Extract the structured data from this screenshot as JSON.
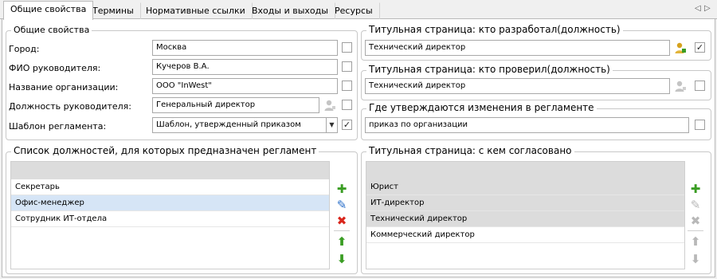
{
  "tabs": [
    "Общие свойства",
    "Термины",
    "Нормативные ссылки",
    "Входы и выходы",
    "Ресурсы"
  ],
  "tab_nav": {
    "prev": "◁",
    "next": "▷"
  },
  "general": {
    "title": "Общие свойства",
    "rows": [
      {
        "label": "Город:",
        "value": "Москва",
        "checked": false
      },
      {
        "label": "ФИО руководителя:",
        "value": "Кучеров В.А.",
        "checked": false
      },
      {
        "label": "Название организации:",
        "value": "ООО \"InWest\"",
        "checked": false
      },
      {
        "label": "Должность руководителя:",
        "value": "Генеральный директор",
        "checked": false
      },
      {
        "label": "Шаблон регламента:",
        "value": "Шаблон, утвержденный приказом",
        "checked": true
      }
    ]
  },
  "developed_by": {
    "title": "Титульная страница: кто разработал(должность)",
    "value": "Технический директор",
    "checked": true
  },
  "checked_by": {
    "title": "Титульная страница: кто проверил(должность)",
    "value": "Технический директор",
    "checked": false
  },
  "changes_approved": {
    "title": "Где утверждаются изменения в регламенте",
    "value": "приказ по организации",
    "checked": false
  },
  "positions_list": {
    "title": "Список должностей, для которых предназначен регламент",
    "items": [
      "Секретарь",
      "Офис-менеджер",
      "Сотрудник ИТ-отдела"
    ],
    "selected_index": 1
  },
  "agreed_list": {
    "title": "Титульная страница: с кем согласовано",
    "items": [
      "Юрист",
      "ИТ-директор",
      "Технический директор",
      "Коммерческий директор"
    ],
    "highlighted_count": 3
  },
  "colors": {
    "add": "#3a9d23",
    "edit": "#2a6fc9",
    "delete": "#d9261c",
    "move": "#3a9d23",
    "selected_row": "#d6e5f6",
    "disabled": "#b8b8b8"
  },
  "check_mark": "✓",
  "dropdown_arrow": "▼"
}
